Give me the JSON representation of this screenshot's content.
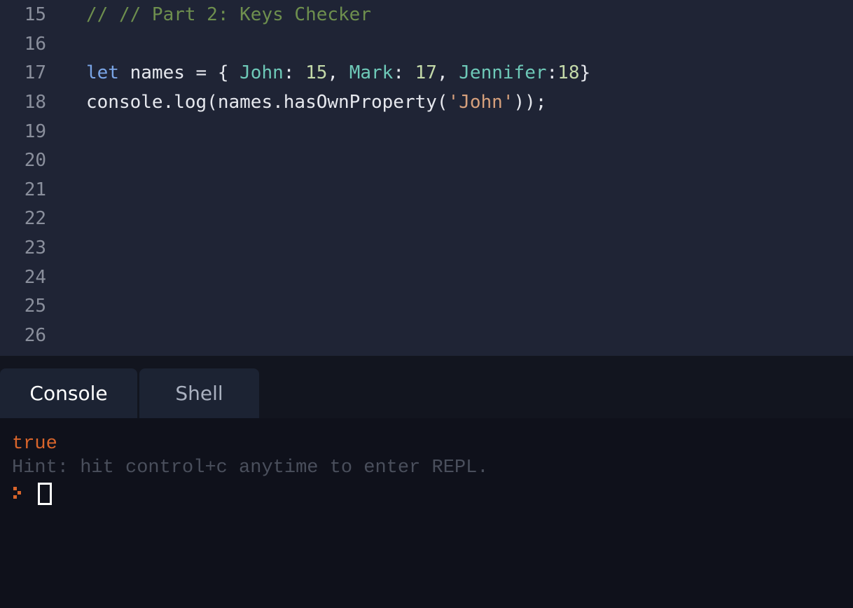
{
  "editor": {
    "lines": [
      {
        "number": "15",
        "tokens": [
          {
            "text": "// // Part 2: Keys Checker",
            "kind": "comment"
          }
        ]
      },
      {
        "number": "16",
        "tokens": []
      },
      {
        "number": "17",
        "tokens": [
          {
            "text": "let",
            "kind": "keyword"
          },
          {
            "text": " names = { ",
            "kind": "plain"
          },
          {
            "text": "John",
            "kind": "prop"
          },
          {
            "text": ": ",
            "kind": "plain"
          },
          {
            "text": "15",
            "kind": "number"
          },
          {
            "text": ", ",
            "kind": "plain"
          },
          {
            "text": "Mark",
            "kind": "prop"
          },
          {
            "text": ": ",
            "kind": "plain"
          },
          {
            "text": "17",
            "kind": "number"
          },
          {
            "text": ", ",
            "kind": "plain"
          },
          {
            "text": "Jennifer",
            "kind": "prop"
          },
          {
            "text": ":",
            "kind": "plain"
          },
          {
            "text": "18",
            "kind": "number"
          },
          {
            "text": "}",
            "kind": "plain"
          }
        ]
      },
      {
        "number": "18",
        "tokens": [
          {
            "text": "console.log(names.hasOwnProperty(",
            "kind": "plain"
          },
          {
            "text": "'John'",
            "kind": "string"
          },
          {
            "text": "));",
            "kind": "plain"
          }
        ]
      },
      {
        "number": "19",
        "tokens": []
      },
      {
        "number": "20",
        "tokens": []
      },
      {
        "number": "21",
        "tokens": []
      },
      {
        "number": "22",
        "tokens": []
      },
      {
        "number": "23",
        "tokens": []
      },
      {
        "number": "24",
        "tokens": []
      },
      {
        "number": "25",
        "tokens": []
      },
      {
        "number": "26",
        "tokens": []
      }
    ]
  },
  "tabs": {
    "console_label": "Console",
    "shell_label": "Shell",
    "active": "Console"
  },
  "console": {
    "output": "true",
    "hint": "Hint: hit control+c anytime to enter REPL.",
    "prompt_icon": "chevron-prompt-icon"
  },
  "colors": {
    "editor_bg": "#1f2435",
    "console_bg": "#0f111b",
    "output_orange": "#d9652b",
    "hint_gray": "#4a4f5c"
  }
}
